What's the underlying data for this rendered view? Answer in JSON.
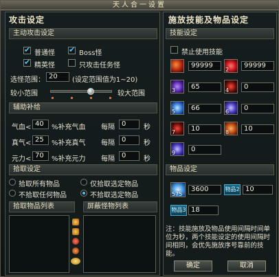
{
  "window": {
    "title": "天人合一设置"
  },
  "left": {
    "title": "攻击设定",
    "auto_attack": {
      "header": "主动攻击设定",
      "options": [
        {
          "label": "普通怪",
          "checked": true
        },
        {
          "label": "Boss怪",
          "checked": true
        },
        {
          "label": "精英怪",
          "checked": true
        },
        {
          "label": "只攻击任务怪",
          "checked": false
        }
      ],
      "range_label": "选怪范围：",
      "range_value": "20",
      "range_hint": "(设定范围值为1~20)",
      "slider_min_label": "较小范围",
      "slider_max_label": "较大范围",
      "slider_fraction": 0.66
    },
    "assist": {
      "header": "辅助补给",
      "rows": [
        {
          "label": "气血<",
          "value": "40",
          "suffix": "%补充气血",
          "every": "每隔",
          "interval": "0",
          "unit": "秒"
        },
        {
          "label": "真气<",
          "value": "25",
          "suffix": "%补充真气",
          "every": "每隔",
          "interval": "0",
          "unit": "秒"
        },
        {
          "label": "元力<",
          "value": "70",
          "suffix": "%补充元力",
          "every": "每隔",
          "interval": "0",
          "unit": "秒"
        }
      ]
    },
    "pickup": {
      "header": "拾取设定",
      "options": [
        {
          "label": "拾取所有物品",
          "checked": false
        },
        {
          "label": "仅拾取选定物品",
          "checked": false
        },
        {
          "label": "不拾取任何物品",
          "checked": false
        },
        {
          "label": "不拾取选定物品",
          "checked": true
        }
      ]
    },
    "pickup_list": {
      "header": "拾取物品列表"
    },
    "block_list": {
      "header": "屏蔽怪物列表"
    }
  },
  "right": {
    "title": "施放技能及物品设定",
    "skills": {
      "header": "技能设定",
      "disable_label": "禁止使用技能",
      "disable_checked": false,
      "slots": [
        {
          "icon": "fire-swirl-icon",
          "badge": "",
          "value": "99999"
        },
        {
          "icon": "red-orb-icon",
          "badge": "2",
          "value": "99999"
        },
        {
          "icon": "purple-flame-icon",
          "badge": "3",
          "value": "65"
        },
        {
          "icon": "dark-red-icon",
          "badge": "4",
          "value": "0"
        },
        {
          "icon": "blue-sparkle-icon",
          "badge": "5",
          "value": "66"
        },
        {
          "icon": "blue-burst-icon",
          "badge": "6",
          "value": "0"
        },
        {
          "icon": "red-slash-icon",
          "badge": "7",
          "value": "10"
        },
        {
          "icon": "orange-flame-icon",
          "badge": "8",
          "value": "10"
        },
        {
          "icon": "violet-rune-icon",
          "badge": "9",
          "value": "0"
        }
      ]
    },
    "items": {
      "header": "物品设定",
      "slot_icon": "glowing-orb-icon",
      "slot_count": "575",
      "slot_value": "3600",
      "item2_label": "物品2",
      "item2_value": "10",
      "item3_label": "物品3",
      "item3_value": "18"
    },
    "note": "注：技能施放及物品使用间隔时间单位为秒，两个技能设定的使用间隔时间相同，会优先施放序号靠前的技能。",
    "ok": "确定",
    "cancel": "取消"
  }
}
